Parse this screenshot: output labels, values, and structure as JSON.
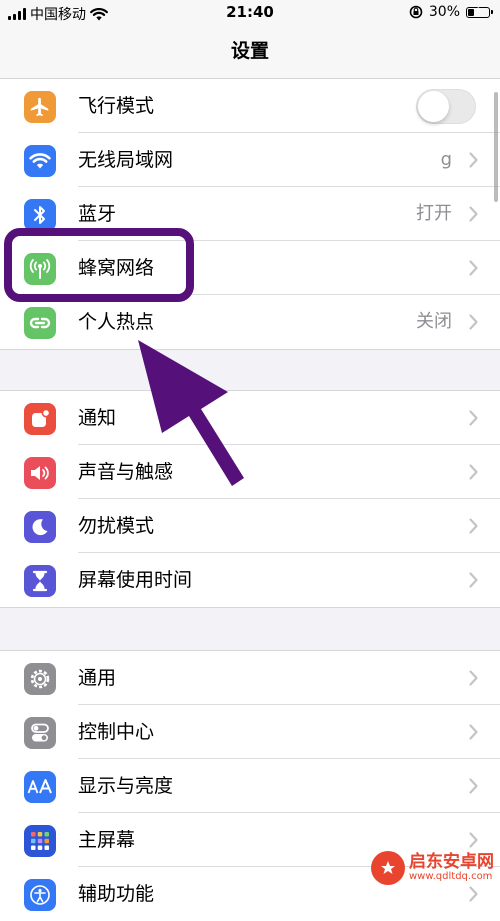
{
  "status_bar": {
    "carrier": "中国移动",
    "time": "21:40",
    "battery_percent": "30%",
    "battery_level": 0.3
  },
  "nav": {
    "title": "设置"
  },
  "groups": [
    {
      "rows": [
        {
          "label": "飞行模式",
          "value": "",
          "icon": "airplane-icon",
          "color": "#f09a37",
          "control": "toggle",
          "toggle_on": false
        },
        {
          "label": "无线局域网",
          "value": "g",
          "icon": "wifi-icon",
          "color": "#3478f6",
          "control": "chevron"
        },
        {
          "label": "蓝牙",
          "value": "打开",
          "icon": "bluetooth-icon",
          "color": "#3478f6",
          "control": "chevron"
        },
        {
          "label": "蜂窝网络",
          "value": "",
          "icon": "cellular-antenna-icon",
          "color": "#65c466",
          "control": "chevron"
        },
        {
          "label": "个人热点",
          "value": "关闭",
          "icon": "hotspot-link-icon",
          "color": "#65c466",
          "control": "chevron"
        }
      ]
    },
    {
      "rows": [
        {
          "label": "通知",
          "value": "",
          "icon": "notification-icon",
          "color": "#eb4e3d",
          "control": "chevron"
        },
        {
          "label": "声音与触感",
          "value": "",
          "icon": "speaker-icon",
          "color": "#eb4e5b",
          "control": "chevron"
        },
        {
          "label": "勿扰模式",
          "value": "",
          "icon": "moon-icon",
          "color": "#5856d6",
          "control": "chevron"
        },
        {
          "label": "屏幕使用时间",
          "value": "",
          "icon": "hourglass-icon",
          "color": "#5856d6",
          "control": "chevron"
        }
      ]
    },
    {
      "rows": [
        {
          "label": "通用",
          "value": "",
          "icon": "gear-icon",
          "color": "#8e8e93",
          "control": "chevron"
        },
        {
          "label": "控制中心",
          "value": "",
          "icon": "switches-icon",
          "color": "#8e8e93",
          "control": "chevron"
        },
        {
          "label": "显示与亮度",
          "value": "",
          "icon": "text-size-icon",
          "color": "#3478f6",
          "control": "chevron"
        },
        {
          "label": "主屏幕",
          "value": "",
          "icon": "home-grid-icon",
          "color": "#2c55d8",
          "control": "chevron"
        },
        {
          "label": "辅助功能",
          "value": "",
          "icon": "accessibility-icon",
          "color": "#3478f6",
          "control": "chevron"
        }
      ]
    }
  ],
  "annotation": {
    "color": "#55107a"
  },
  "watermark": {
    "name": "启东安卓网",
    "url": "www.qdltdq.com"
  }
}
